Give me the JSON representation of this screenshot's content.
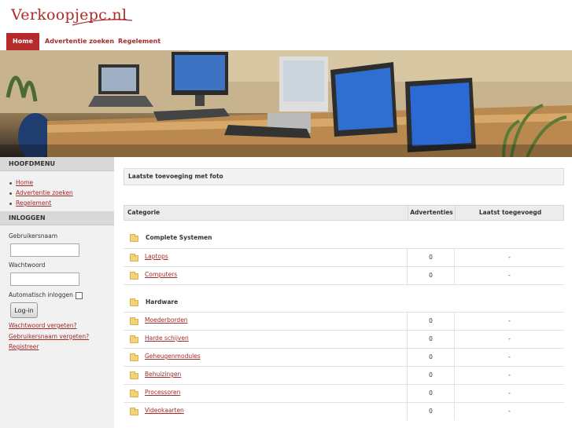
{
  "site": {
    "logo_text": "Verkoopjepc.nl"
  },
  "nav": {
    "items": [
      "Home",
      "Advertentie zoeken",
      "Regelement"
    ],
    "active": "Home"
  },
  "colors": {
    "brand": "#b52b2b",
    "link": "#a52a2a"
  },
  "sidebar": {
    "menu_heading": "HOOFDMENU",
    "menu_items": [
      "Home",
      "Advertentie zoeken",
      "Regelement"
    ],
    "login_heading": "INLOGGEN",
    "username_label": "Gebruikersnaam",
    "username_value": "",
    "password_label": "Wachtwoord",
    "password_value": "",
    "auto_login_label": "Automatisch inloggen",
    "login_button": "Log-in",
    "links": [
      "Wachtwoord vergeten?",
      "Gebruikersnaam vergeten?",
      "Registreer"
    ]
  },
  "main": {
    "latest_heading": "Laatste toevoeging met foto",
    "table": {
      "headers": {
        "category": "Categorie",
        "ads": "Advertenties",
        "last": "Laatst toegevoegd"
      },
      "groups": [
        {
          "title": "Complete Systemen",
          "rows": [
            {
              "name": "Laptops",
              "count": "0",
              "last": "-"
            },
            {
              "name": "Computers",
              "count": "0",
              "last": "-"
            }
          ]
        },
        {
          "title": "Hardware",
          "rows": [
            {
              "name": "Moederborden",
              "count": "0",
              "last": "-"
            },
            {
              "name": "Harde schijven",
              "count": "0",
              "last": "-"
            },
            {
              "name": "Geheugenmodules",
              "count": "0",
              "last": "-"
            },
            {
              "name": "Behuizingen",
              "count": "0",
              "last": "-"
            },
            {
              "name": "Processoren",
              "count": "0",
              "last": "-"
            },
            {
              "name": "Videokaarten",
              "count": "0",
              "last": "-"
            }
          ]
        }
      ]
    }
  }
}
